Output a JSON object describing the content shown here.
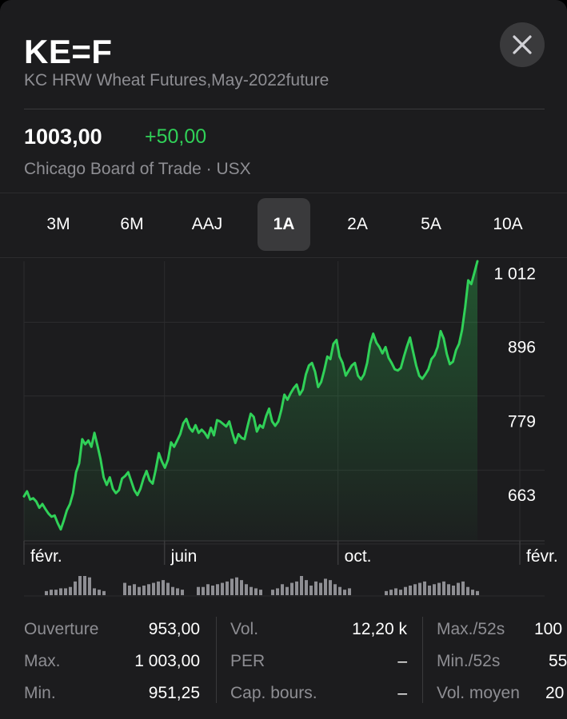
{
  "header": {
    "ticker": "KE=F",
    "subtitle": "KC HRW Wheat Futures,May-2022future",
    "price": "1003,00",
    "change": "+50,00",
    "exchange": "Chicago Board of Trade · USX",
    "close_icon": "close-icon"
  },
  "ranges": [
    {
      "label": "3M",
      "active": false
    },
    {
      "label": "6M",
      "active": false
    },
    {
      "label": "AAJ",
      "active": false
    },
    {
      "label": "1A",
      "active": true
    },
    {
      "label": "2A",
      "active": false
    },
    {
      "label": "5A",
      "active": false
    },
    {
      "label": "10A",
      "active": false
    }
  ],
  "colors": {
    "accent_green": "#30d158",
    "background": "#1c1c1e",
    "secondary_text": "#8e8e93",
    "grid": "#3a3a3c"
  },
  "chart_data": {
    "type": "area",
    "y_ticks": [
      1012,
      896,
      779,
      663
    ],
    "ylim": [
      590,
      1030
    ],
    "x_tick_labels": [
      "févr.",
      "juin",
      "oct.",
      "févr."
    ],
    "x_tick_positions": [
      0,
      17,
      38,
      60
    ],
    "x_max": 63,
    "grid": true,
    "series": [
      {
        "values": [
          660,
          668,
          655,
          657,
          652,
          642,
          648,
          640,
          633,
          628,
          630,
          618,
          608,
          622,
          638,
          648,
          665,
          698,
          712,
          750,
          742,
          748,
          738,
          760,
          740,
          718,
          690,
          678,
          690,
          672,
          665,
          670,
          688,
          692,
          698,
          684,
          670,
          662,
          672,
          688,
          700,
          685,
          680,
          702,
          728,
          715,
          705,
          718,
          745,
          738,
          748,
          758,
          775,
          782,
          768,
          762,
          772,
          760,
          765,
          760,
          752,
          768,
          756,
          780,
          778,
          774,
          770,
          778,
          760,
          744,
          758,
          752,
          750,
          771,
          790,
          785,
          762,
          772,
          768,
          786,
          798,
          778,
          771,
          778,
          796,
          820,
          812,
          822,
          830,
          836,
          820,
          828,
          852,
          866,
          870,
          856,
          832,
          840,
          858,
          880,
          876,
          900,
          906,
          880,
          870,
          850,
          858,
          866,
          870,
          850,
          844,
          852,
          870,
          900,
          916,
          902,
          895,
          885,
          895,
          878,
          870,
          860,
          858,
          862,
          880,
          896,
          910,
          888,
          866,
          850,
          845,
          852,
          860,
          876,
          882,
          895,
          920,
          908,
          884,
          868,
          872,
          890,
          900,
          922,
          958,
          1000,
          994,
          1012,
          1030
        ],
        "xlim": [
          0,
          62.5
        ]
      }
    ],
    "volume_groups": [
      [
        3,
        4,
        4,
        5,
        5,
        6,
        10,
        14,
        14,
        13,
        5,
        4,
        3
      ],
      [
        9,
        7,
        8,
        6,
        7,
        8,
        9,
        10,
        11,
        9,
        6,
        5,
        4
      ],
      [
        6,
        6,
        8,
        7,
        8,
        9,
        10,
        12,
        13,
        11,
        8,
        6,
        5,
        4
      ],
      [
        4,
        5,
        8,
        6,
        9,
        10,
        14,
        11,
        7,
        10,
        9,
        12,
        11,
        8,
        6,
        4,
        5
      ],
      [
        3,
        4,
        5,
        4,
        6,
        7,
        8,
        9,
        10,
        7,
        8,
        9,
        10,
        8,
        7,
        9,
        10,
        6,
        4,
        3
      ]
    ]
  },
  "stats": {
    "col1": [
      {
        "label": "Ouverture",
        "value": "953,00"
      },
      {
        "label": "Max.",
        "value": "1 003,00"
      },
      {
        "label": "Min.",
        "value": "951,25"
      }
    ],
    "col2": [
      {
        "label": "Vol.",
        "value": "12,20 k"
      },
      {
        "label": "PER",
        "value": "–"
      },
      {
        "label": "Cap. bours.",
        "value": "–"
      }
    ],
    "col3": [
      {
        "label": "Max./52s",
        "value": "100"
      },
      {
        "label": "Min./52s",
        "value": "55"
      },
      {
        "label": "Vol. moyen",
        "value": "20"
      }
    ]
  }
}
